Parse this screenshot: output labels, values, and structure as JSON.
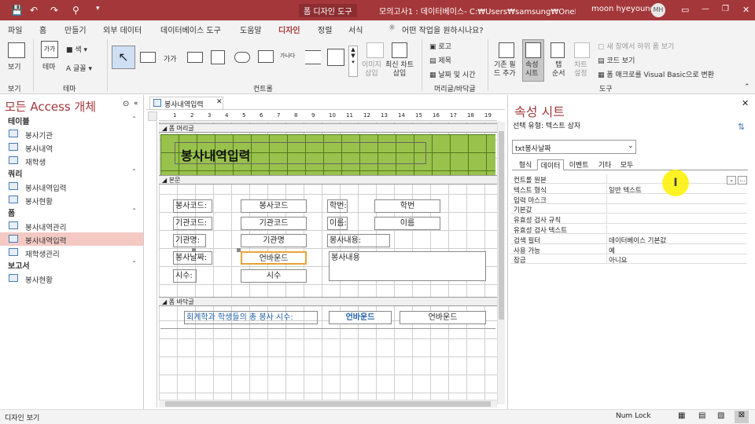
{
  "titlebar": {
    "tool": "폼 디자인 도구",
    "doc": "모의고사1 : 데이터베이스- C:₩Users₩samsung₩OneDrive₩...",
    "user": "moon hyeyoung",
    "initials": "MH"
  },
  "tabs": [
    "파일",
    "홈",
    "만들기",
    "외부 데이터",
    "데이터베이스 도구",
    "도움말",
    "디자인",
    "정렬",
    "서식"
  ],
  "search": "어떤 작업을 원하시나요?",
  "ribbon": {
    "view": "보기",
    "view_group": "보기",
    "theme": "테마",
    "color": "색",
    "font": "글꼴",
    "theme_group": "테마",
    "controls_group": "컨트롤",
    "image_insert": "이미지\n삽입",
    "chart": "최신 차트\n삽입",
    "logo": "로고",
    "title": "제목",
    "datetime": "날짜 및 시간",
    "header_group": "머리글/바닥글",
    "add_fields": "기존 필\n드 추가",
    "property_sheet": "속성\n시트",
    "tab_order": "탭\n순서",
    "chart_settings": "차트\n설정",
    "subform": "새 창에서 하위 폼 보기",
    "view_code": "코드 보기",
    "vba": "폼 매크로를 Visual Basic으로 변환",
    "tools_group": "도구",
    "gaga": "가가",
    "gana": "가나다"
  },
  "nav": {
    "title": "모든 Access 개체",
    "sections": [
      {
        "name": "테이블",
        "items": [
          "봉사기관",
          "봉사내역",
          "재학생"
        ]
      },
      {
        "name": "쿼리",
        "items": [
          "봉사내역입력",
          "봉사현황"
        ]
      },
      {
        "name": "폼",
        "items": [
          "봉사내역관리",
          "봉사내역입력",
          "재학생관리"
        ]
      },
      {
        "name": "보고서",
        "items": [
          "봉사현황"
        ]
      }
    ]
  },
  "document": {
    "tab": "봉사내역입력",
    "form_header": "폼 머리글",
    "detail": "본문",
    "form_footer": "폼 바닥글",
    "heading": "봉사내역입력",
    "labels": [
      "봉사코드:",
      "기관코드:",
      "기관명:",
      "봉사날짜:",
      "시수:",
      "학번:",
      "이름:",
      "봉사내용:"
    ],
    "fields": [
      "봉사코드",
      "기관코드",
      "기관명",
      "언바운드",
      "시수",
      "학번",
      "이름",
      "봉사내용"
    ],
    "footer_label": "회계학과 학생들의 총 봉사 시수:",
    "footer_field1": "언바운드",
    "footer_field2": "언바운드",
    "ruler": [
      "1",
      "2",
      "3",
      "4",
      "5",
      "6",
      "7",
      "8",
      "9",
      "10",
      "11",
      "12",
      "13",
      "14",
      "15",
      "16",
      "17",
      "18",
      "19"
    ]
  },
  "props": {
    "title": "속성 시트",
    "selection_type": "선택 유형: 텍스트 상자",
    "selected": "txt봉사날짜",
    "tabs": [
      "형식",
      "데이터",
      "이벤트",
      "기타",
      "모두"
    ],
    "active_tab": "데이터",
    "rows": [
      {
        "k": "컨트롤 원본",
        "v": ""
      },
      {
        "k": "텍스트 형식",
        "v": "일반 텍스트"
      },
      {
        "k": "입력 마스크",
        "v": ""
      },
      {
        "k": "기본값",
        "v": ""
      },
      {
        "k": "유효성 검사 규칙",
        "v": ""
      },
      {
        "k": "유효성 검사 텍스트",
        "v": ""
      },
      {
        "k": "검색 필터",
        "v": "데이터베이스 기본값"
      },
      {
        "k": "사용 가능",
        "v": "예"
      },
      {
        "k": "잠금",
        "v": "아니요"
      }
    ]
  },
  "status": {
    "left": "디자인 보기",
    "numlock": "Num Lock"
  },
  "colors": {
    "title": "#a4373a",
    "accent": "#c43e1c",
    "header_green": "#99c24d",
    "highlight": "#fff200"
  }
}
